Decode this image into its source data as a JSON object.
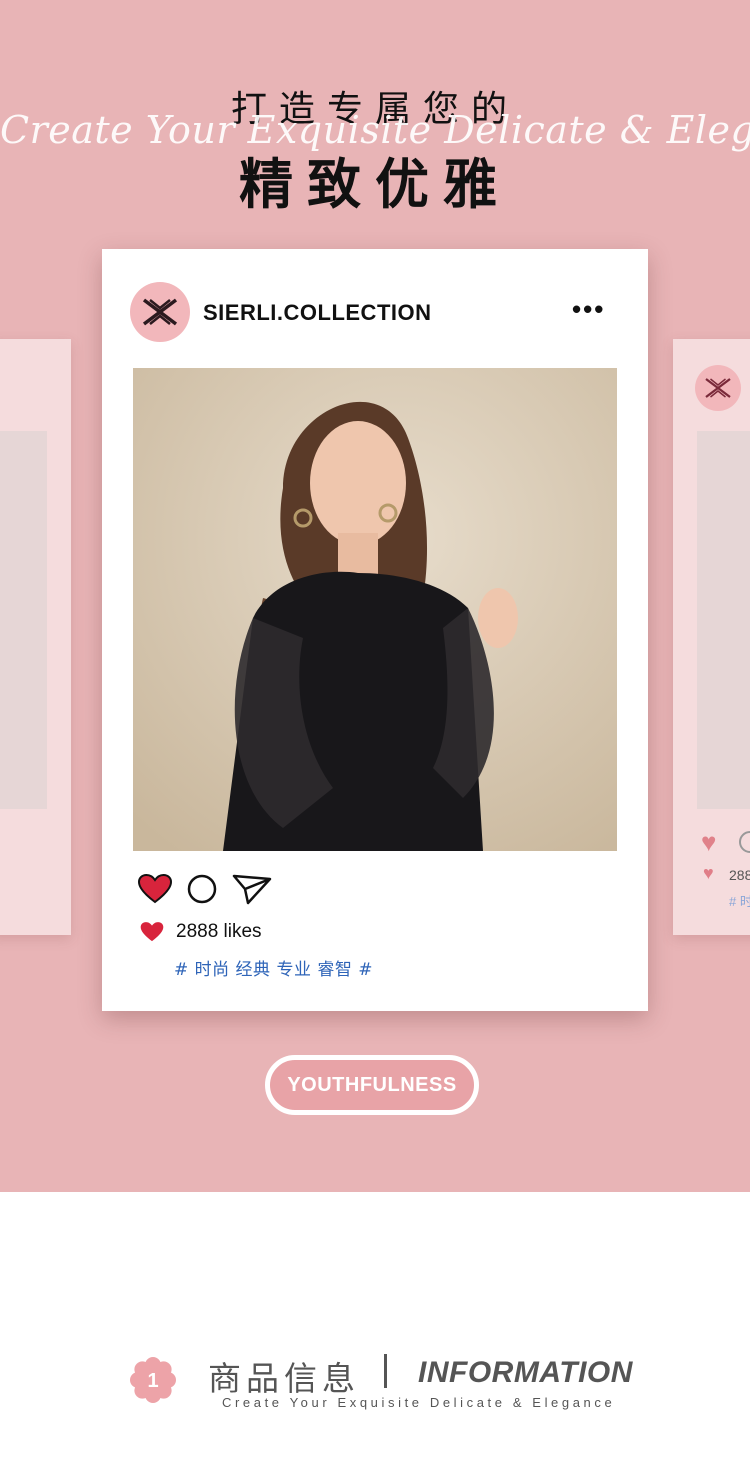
{
  "hero": {
    "headline_line1": "打造专属您的",
    "script_line": "Create Your Exquisite Delicate & Elegance",
    "headline_line2": "精致优雅"
  },
  "post": {
    "username": "SIERLI.COLLECTION",
    "more_label": "•••",
    "likes": "2888 likes",
    "hashtags": "# 时尚 经典 专业 睿智 #"
  },
  "side_post": {
    "likes_partial": "288",
    "tag_partial": "# 时"
  },
  "pill": {
    "label": "YOUTHFULNESS"
  },
  "info": {
    "badge_number": "1",
    "title_cn": "商品信息",
    "title_en": "INFORMATION",
    "subtitle": "Create Your Exquisite Delicate & Elegance"
  },
  "colors": {
    "hero_bg": "#e8b4b6",
    "avatar_bg": "#f2b7bb",
    "heart": "#d8243c",
    "hashtag": "#2e64b8",
    "pill_bg": "#e8a3a7"
  },
  "icons": [
    "brand-logo-icon",
    "heart-icon",
    "comment-icon",
    "share-icon",
    "flower-badge-icon"
  ]
}
